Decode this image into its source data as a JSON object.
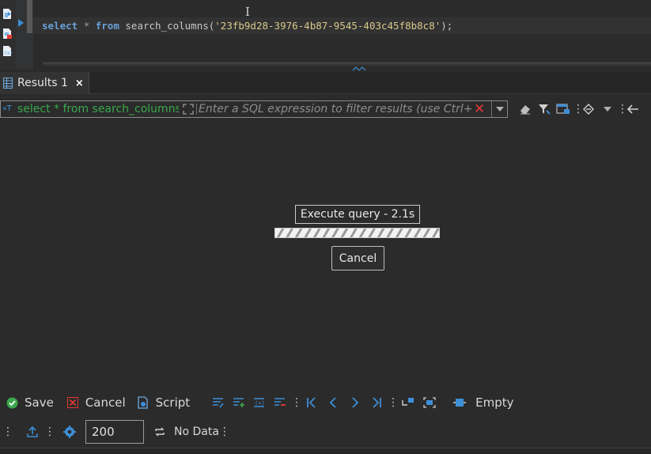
{
  "editor": {
    "sql": {
      "keyword_select": "select",
      "star": "*",
      "keyword_from": "from",
      "function_name": "search_columns",
      "open_paren": "(",
      "string_literal": "'23fb9d28-3976-4b87-9545-403c45f8b8c8'",
      "close": ");"
    },
    "text_cursor": "I"
  },
  "results_tab": {
    "label": "Results 1",
    "close_symbol": "×"
  },
  "filter": {
    "history_symbol": "«T",
    "query_preview": "select * from search_columns",
    "placeholder": "Enter a SQL expression to filter results (use Ctrl+Space)",
    "clear_symbol": "✕"
  },
  "overlay": {
    "status": "Execute query - 2.1s",
    "progress_fraction": 1.0,
    "cancel_label": "Cancel"
  },
  "toolbar_bottom": {
    "save_label": "Save",
    "cancel_label": "Cancel",
    "script_label": "Script",
    "empty_label": "Empty",
    "separator": "⋮"
  },
  "statusbar": {
    "fetch_size": "200",
    "no_data_label": "No Data"
  },
  "colors": {
    "accent": "#3d8fd6",
    "save_green": "#3aa84c",
    "cancel_red": "#e53935"
  }
}
